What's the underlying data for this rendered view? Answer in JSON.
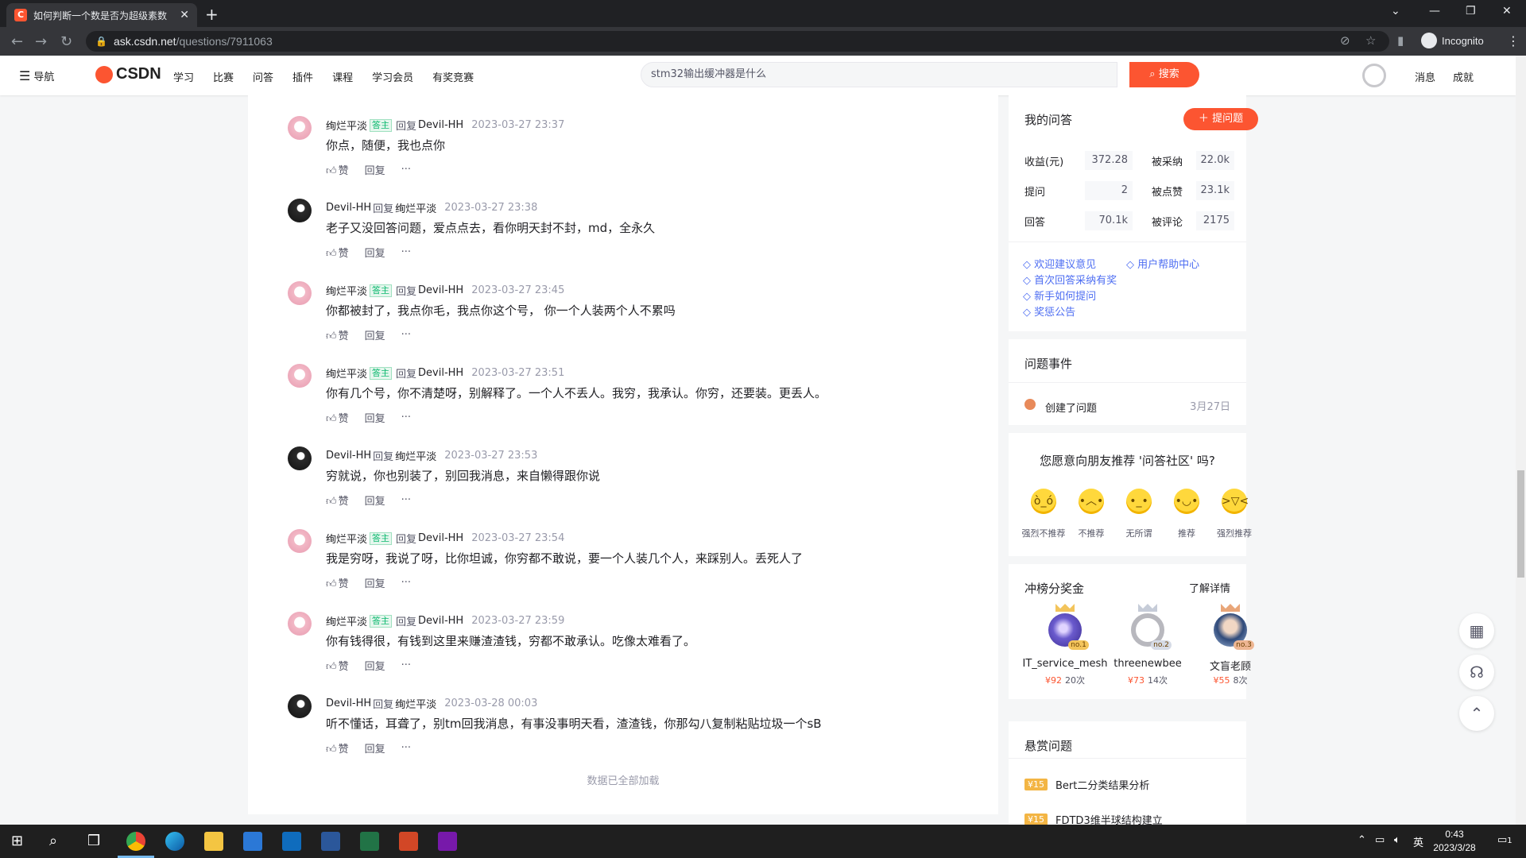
{
  "browser": {
    "tab_title": "如何判断一个数是否为超级素数",
    "url_host": "ask.csdn.net",
    "url_path": "/questions/7911063",
    "profile_label": "Incognito"
  },
  "header": {
    "nav_label": "导航",
    "logo_text": "CSDN",
    "nav_items": [
      "学习",
      "比赛",
      "问答",
      "插件",
      "课程",
      "学习会员",
      "有奖竞赛"
    ],
    "search_placeholder": "stm32输出缓冲器是什么",
    "search_button": "搜索",
    "messages": "消息",
    "achievements": "成就"
  },
  "comments": [
    {
      "avatar": "pink",
      "name": "绚烂平淡",
      "badge": "答主",
      "reply_word": "回复",
      "target": "Devil-HH",
      "time": "2023-03-27 23:37",
      "text": "你点，随便，我也点你"
    },
    {
      "avatar": "dark",
      "name": "Devil-HH",
      "badge": "",
      "reply_word": "回复",
      "target": "绚烂平淡",
      "time": "2023-03-27 23:38",
      "text": "老子又没回答问题，爱点点去，看你明天封不封，md，全永久"
    },
    {
      "avatar": "pink",
      "name": "绚烂平淡",
      "badge": "答主",
      "reply_word": "回复",
      "target": "Devil-HH",
      "time": "2023-03-27 23:45",
      "text": "你都被封了，我点你毛，我点你这个号， 你一个人装两个人不累吗"
    },
    {
      "avatar": "pink",
      "name": "绚烂平淡",
      "badge": "答主",
      "reply_word": "回复",
      "target": "Devil-HH",
      "time": "2023-03-27 23:51",
      "text": "你有几个号，你不清楚呀，别解释了。一个人不丢人。我穷，我承认。你穷，还要装。更丢人。"
    },
    {
      "avatar": "dark",
      "name": "Devil-HH",
      "badge": "",
      "reply_word": "回复",
      "target": "绚烂平淡",
      "time": "2023-03-27 23:53",
      "text": "穷就说，你也别装了，别回我消息，来自懒得跟你说"
    },
    {
      "avatar": "pink",
      "name": "绚烂平淡",
      "badge": "答主",
      "reply_word": "回复",
      "target": "Devil-HH",
      "time": "2023-03-27 23:54",
      "text": "我是穷呀，我说了呀，比你坦诚，你穷都不敢说，要一个人装几个人，来踩别人。丢死人了"
    },
    {
      "avatar": "pink",
      "name": "绚烂平淡",
      "badge": "答主",
      "reply_word": "回复",
      "target": "Devil-HH",
      "time": "2023-03-27 23:59",
      "text": "你有钱得很，有钱到这里来赚渣渣钱，穷都不敢承认。吃像太难看了。"
    },
    {
      "avatar": "dark",
      "name": "Devil-HH",
      "badge": "",
      "reply_word": "回复",
      "target": "绚烂平淡",
      "time": "2023-03-28 00:03",
      "text": "听不懂话，耳聋了，别tm回我消息，有事没事明天看，渣渣钱，你那勾八复制粘贴垃圾一个sB"
    }
  ],
  "comment_actions": {
    "like": "赞",
    "reply": "回复",
    "more": "···"
  },
  "loaded_text": "数据已全部加载",
  "my_qa": {
    "title": "我的问答",
    "ask_button": "提问题",
    "stats": [
      {
        "label": "收益(元)",
        "value": "372.28"
      },
      {
        "label": "被采纳",
        "value": "22.0k"
      },
      {
        "label": "提问",
        "value": "2"
      },
      {
        "label": "被点赞",
        "value": "23.1k"
      },
      {
        "label": "回答",
        "value": "70.1k"
      },
      {
        "label": "被评论",
        "value": "2175"
      }
    ],
    "links": [
      "欢迎建议意见",
      "用户帮助中心",
      "首次回答采纳有奖",
      "新手如何提问",
      "奖惩公告"
    ]
  },
  "events": {
    "title": "问题事件",
    "item_text": "创建了问题",
    "item_date": "3月27日"
  },
  "survey": {
    "title": "您愿意向朋友推荐 '问答社区' 吗?",
    "options": [
      "强烈不推荐",
      "不推荐",
      "无所谓",
      "推荐",
      "强烈推荐"
    ]
  },
  "leaderboard": {
    "title": "冲榜分奖金",
    "detail_link": "了解详情",
    "entries": [
      {
        "rank": "no.1",
        "name": "IT_service_mesh",
        "money": "¥92",
        "count": "20次"
      },
      {
        "rank": "no.2",
        "name": "threenewbee",
        "money": "¥73",
        "count": "14次"
      },
      {
        "rank": "no.3",
        "name": "文盲老顾",
        "money": "¥55",
        "count": "8次"
      }
    ]
  },
  "bounty": {
    "title": "悬赏问题",
    "items": [
      {
        "tag": "¥15",
        "text": "Bert二分类结果分析"
      },
      {
        "tag": "¥15",
        "text": "FDTD3维半球结构建立"
      }
    ]
  },
  "taskbar": {
    "ime": "英",
    "time": "0:43",
    "date": "2023/3/28",
    "notifications": "1"
  }
}
